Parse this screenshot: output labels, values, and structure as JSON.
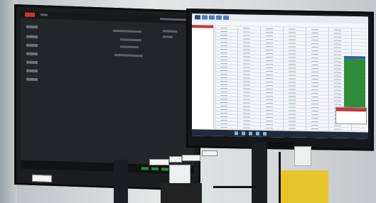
{
  "scene": {
    "description_colors": {
      "wall": "#d8dbdc",
      "monitor_bezel": "#0c0d0e",
      "spreadsheet_bg": "#f4f6f8",
      "accent_green": "#2e8b3b",
      "accent_red": "#c23a3a",
      "sticky_box": "#e7c62b"
    }
  },
  "left_monitor": {
    "icons": [
      "folder-icon",
      "file-icon"
    ]
  },
  "right_monitor": {
    "icons": [
      "spreadsheet-icon"
    ]
  }
}
